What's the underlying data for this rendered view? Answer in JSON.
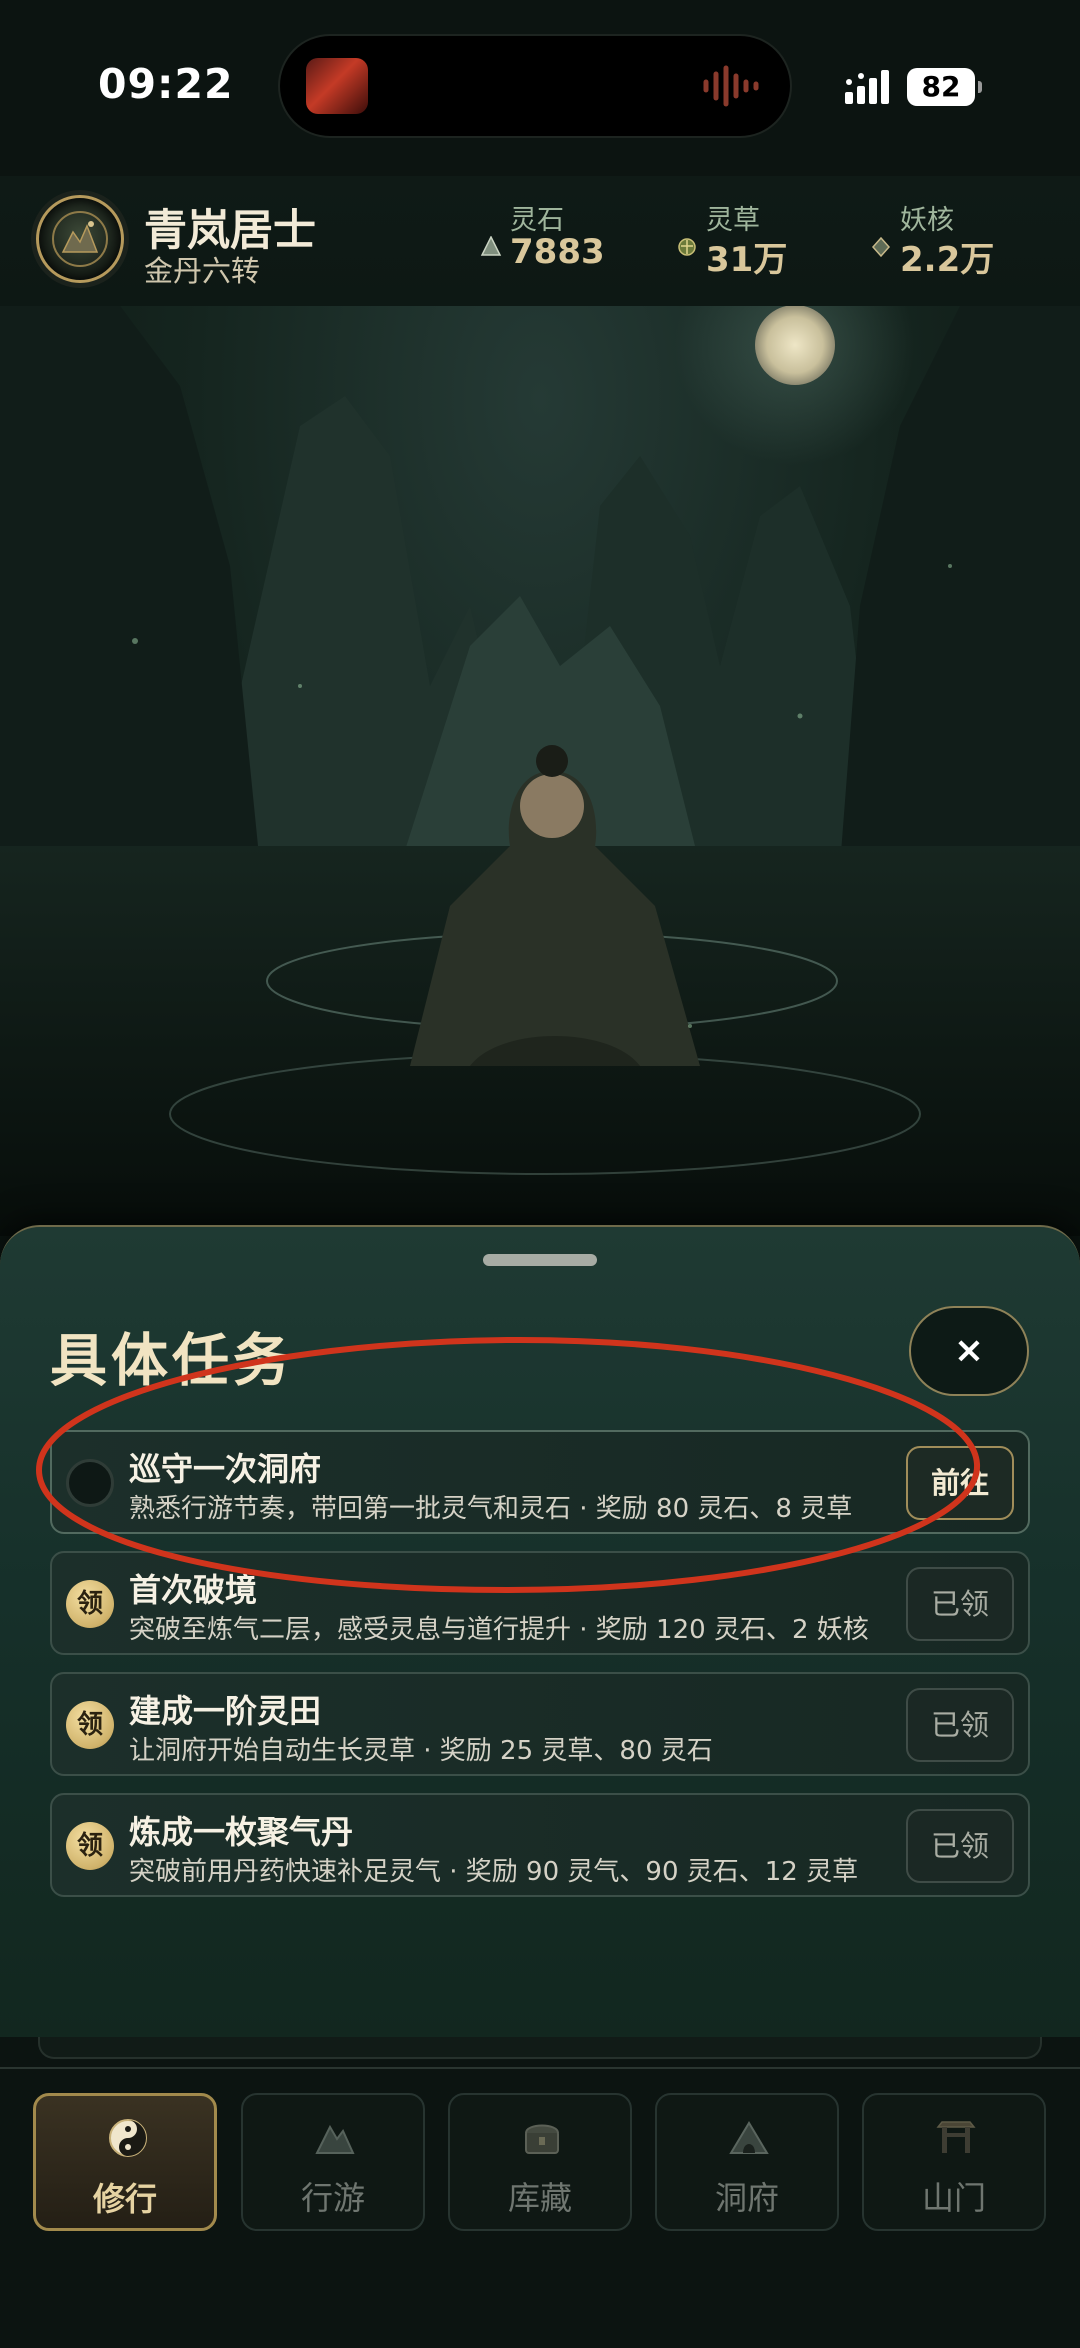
{
  "status_bar": {
    "time": "09:22",
    "battery": "82"
  },
  "player": {
    "name": "青岚居士",
    "rank": "金丹六转",
    "avatar_icon": "sect-emblem-icon"
  },
  "resources": [
    {
      "label": "灵石",
      "value": "7883",
      "icon": "spirit-stone-icon"
    },
    {
      "label": "灵草",
      "value": "31万",
      "icon": "spirit-herb-icon"
    },
    {
      "label": "妖核",
      "value": "2.2万",
      "icon": "demon-core-icon"
    }
  ],
  "scene": {
    "description_icon": "meditation-scene"
  },
  "sheet": {
    "title": "具体任务",
    "close_label": "×",
    "tasks": [
      {
        "title": "巡守一次洞府",
        "desc": "熟悉行游节奏，带回第一批灵气和灵石 · 奖励 80 灵石、8 灵草",
        "state": "todo",
        "action": "前往"
      },
      {
        "title": "首次破境",
        "desc": "突破至炼气二层，感受灵息与道行提升 · 奖励 120 灵石、2 妖核",
        "state": "claimed",
        "badge": "领",
        "action": "已领"
      },
      {
        "title": "建成一阶灵田",
        "desc": "让洞府开始自动生长灵草 · 奖励 25 灵草、80 灵石",
        "state": "claimed",
        "badge": "领",
        "action": "已领"
      },
      {
        "title": "炼成一枚聚气丹",
        "desc": "突破前用丹药快速补足灵气 · 奖励 90 灵气、90 灵石、12 灵草",
        "state": "claimed",
        "badge": "领",
        "action": "已领"
      }
    ]
  },
  "nav": {
    "tabs": [
      {
        "label": "修行",
        "icon": "yin-yang-icon",
        "active": true
      },
      {
        "label": "行游",
        "icon": "mountain-icon",
        "active": false
      },
      {
        "label": "库藏",
        "icon": "treasure-chest-icon",
        "active": false
      },
      {
        "label": "洞府",
        "icon": "cave-dwelling-icon",
        "active": false
      },
      {
        "label": "山门",
        "icon": "sect-gate-icon",
        "active": false
      }
    ]
  },
  "colors": {
    "accent_gold": "#d9c79b",
    "sheet_bg": "#16302a",
    "annotation_red": "#d0341c"
  }
}
